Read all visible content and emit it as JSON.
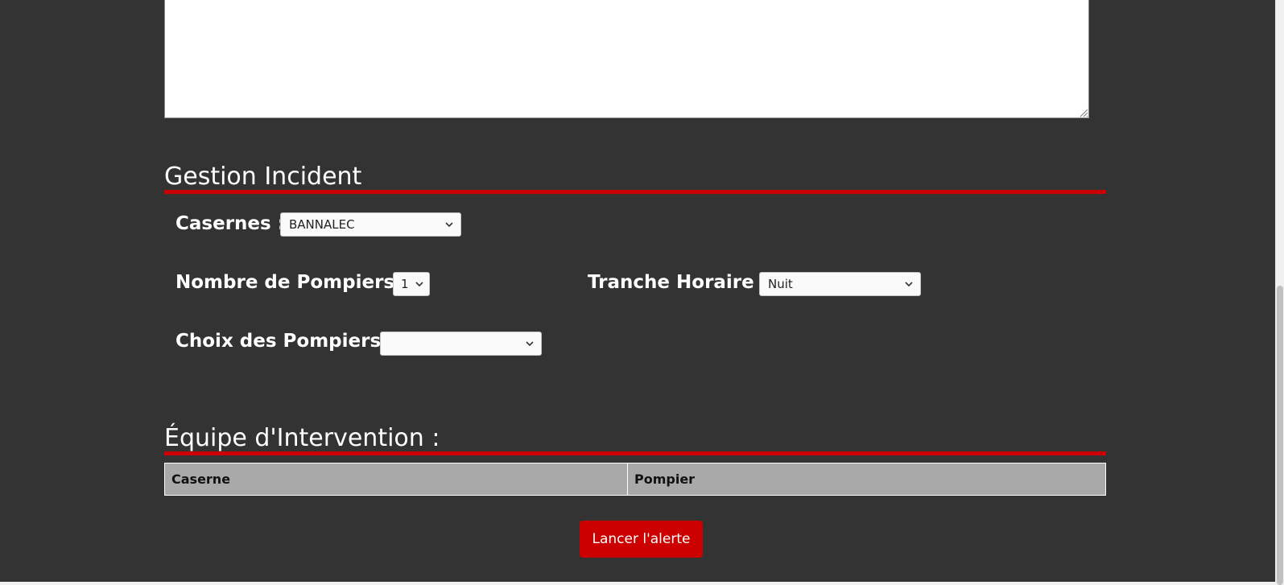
{
  "gestion": {
    "title": "Gestion Incident",
    "casernes_label": "Casernes :",
    "casernes_value": "BANNALEC",
    "nombre_label": "Nombre de Pompiers :",
    "nombre_value": "1",
    "tranche_label": "Tranche Horaire :",
    "tranche_value": "Nuit",
    "choix_label": "Choix des Pompiers :",
    "choix_value": ""
  },
  "equipe": {
    "title": "Équipe d'Intervention :",
    "columns": [
      "Caserne",
      "Pompier"
    ]
  },
  "actions": {
    "alert_label": "Lancer l'alerte"
  },
  "colors": {
    "background": "#333333",
    "accent": "#cc0000",
    "table_header": "#a9a9a9"
  },
  "icons": {
    "select_arrow": "chevron-down-icon",
    "textarea_grip": "resize-grip-icon"
  }
}
